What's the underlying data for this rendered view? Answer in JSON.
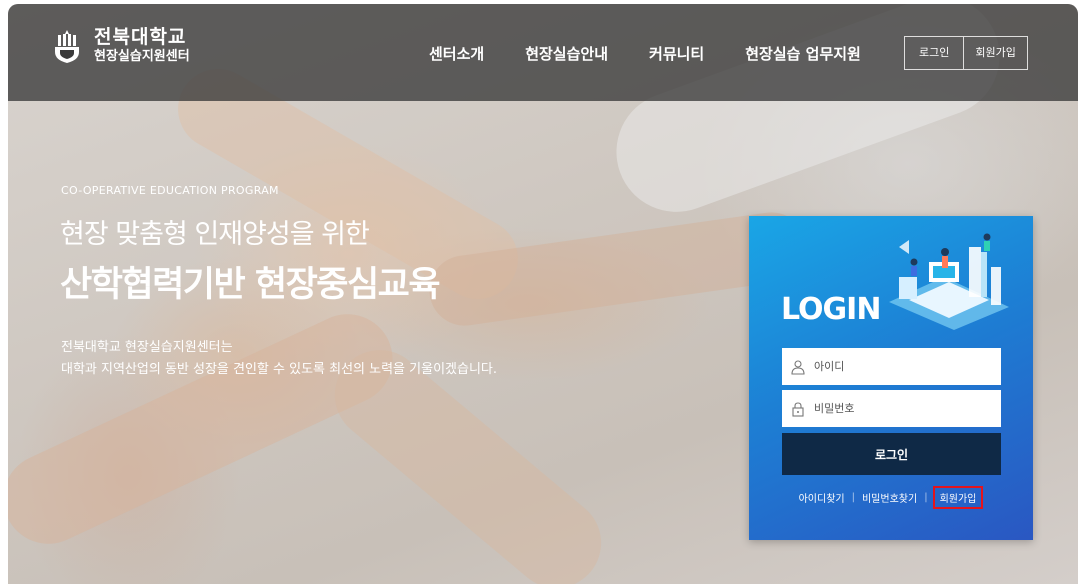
{
  "header": {
    "logo_main": "전북대학교",
    "logo_sub": "현장실습지원센터",
    "nav": [
      {
        "label": "센터소개"
      },
      {
        "label": "현장실습안내"
      },
      {
        "label": "커뮤니티"
      },
      {
        "label": "현장실습 업무지원"
      }
    ],
    "login_link": "로그인",
    "signup_link": "회원가입"
  },
  "hero": {
    "eng": "CO-OPERATIVE EDUCATION PROGRAM",
    "line1": "현장 맞춤형 인재양성을 위한",
    "line2": "산학협력기반 현장중심교육",
    "desc1": "전북대학교 현장실습지원센터는",
    "desc2": "대학과 지역산업의 동반 성장을 견인할 수 있도록 최선의 노력을 기울이겠습니다."
  },
  "login": {
    "title": "LOGIN",
    "id_placeholder": "아이디",
    "pw_placeholder": "비밀번호",
    "button": "로그인",
    "find_id": "아이디찾기",
    "find_pw": "비밀번호찾기",
    "signup": "회원가입",
    "separator": "|"
  },
  "colors": {
    "header_bg": "#3a3a3a",
    "login_gradient_start": "#1aa6e6",
    "login_gradient_end": "#2a57c2",
    "login_button": "#0f2946",
    "highlight_border": "#e4141d"
  }
}
